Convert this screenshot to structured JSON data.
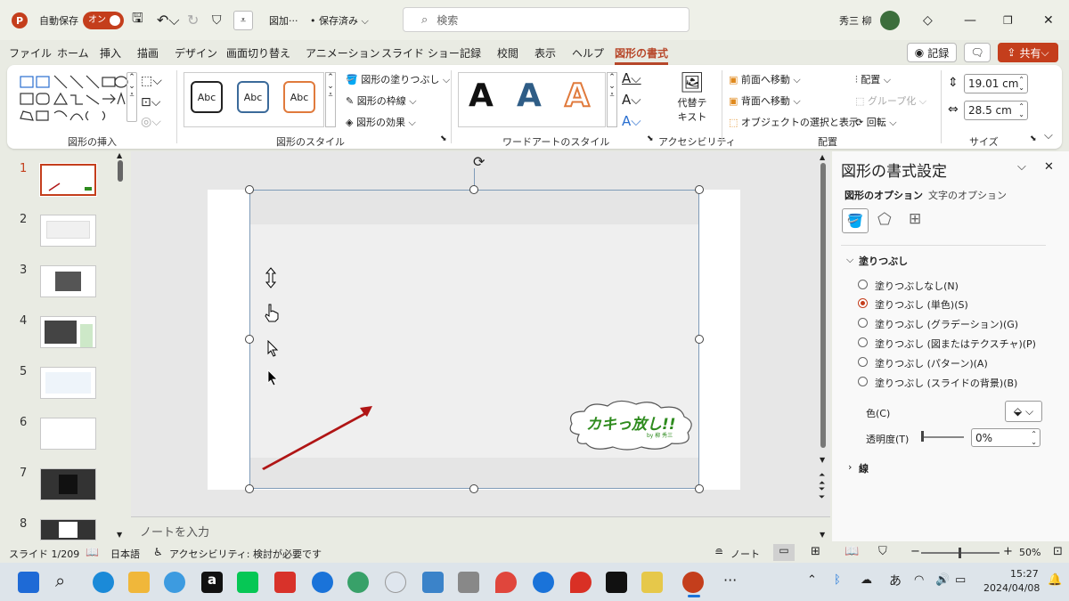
{
  "titlebar": {
    "autosave_label": "自動保存",
    "autosave_toggle": "オン",
    "file_name": "図加···",
    "saved_status": "• 保存済み ⌵",
    "search_placeholder": "検索",
    "user_name": "秀三 柳"
  },
  "tabs": [
    "ファイル",
    "ホーム",
    "挿入",
    "描画",
    "デザイン",
    "画面切り替え",
    "アニメーション",
    "スライド ショー",
    "記録",
    "校閲",
    "表示",
    "ヘルプ",
    "図形の書式"
  ],
  "tab_actions": {
    "record": "記録",
    "share": "共有"
  },
  "ribbon": {
    "groups": {
      "insert_shapes": "図形の挿入",
      "shape_styles": "図形のスタイル",
      "wordart_styles": "ワードアートのスタイル",
      "accessibility": "アクセシビリティ",
      "arrange": "配置",
      "size": "サイズ"
    },
    "style_sample": "Abc",
    "shape_fill": "図形の塗りつぶし",
    "shape_outline": "図形の枠線",
    "shape_effects": "図形の効果",
    "alt_text_1": "代替テ",
    "alt_text_2": "キスト",
    "bring_forward": "前面へ移動",
    "send_backward": "背面へ移動",
    "selection_pane": "オブジェクトの選択と表示",
    "align": "配置",
    "group": "グループ化",
    "rotate": "回転",
    "height": "19.01 cm",
    "width": "28.5 cm",
    "wordart_letter": "A"
  },
  "slides": {
    "numbers": [
      "1",
      "2",
      "3",
      "4",
      "5",
      "6",
      "7",
      "8"
    ],
    "selected": 1
  },
  "slide_content": {
    "logo_text": "カキっ放し!!",
    "logo_by": "by 柳 秀三"
  },
  "notes_placeholder": "ノートを入力",
  "format_panel": {
    "title": "図形の書式設定",
    "tab_shape": "図形のオプション",
    "tab_text": "文字のオプション",
    "fill_section": "塗りつぶし",
    "fill_options": [
      "塗りつぶしなし(N)",
      "塗りつぶし (単色)(S)",
      "塗りつぶし (グラデーション)(G)",
      "塗りつぶし (図またはテクスチャ)(P)",
      "塗りつぶし (パターン)(A)",
      "塗りつぶし (スライドの背景)(B)"
    ],
    "selected_fill": 1,
    "color_label": "色(C)",
    "transparency_label": "透明度(T)",
    "transparency_value": "0%",
    "line_section": "線"
  },
  "statusbar": {
    "slide_info": "スライド 1/209",
    "language": "日本語",
    "accessibility": "アクセシビリティ: 検討が必要です",
    "notes": "ノート",
    "zoom": "50%"
  },
  "taskbar": {
    "time": "15:27",
    "date": "2024/04/08",
    "ime": "あ"
  },
  "colors": {
    "accent": "#b7472a",
    "toggle": "#c43e1c",
    "arrow": "#b01515",
    "logo_green": "#2e8b1e"
  }
}
